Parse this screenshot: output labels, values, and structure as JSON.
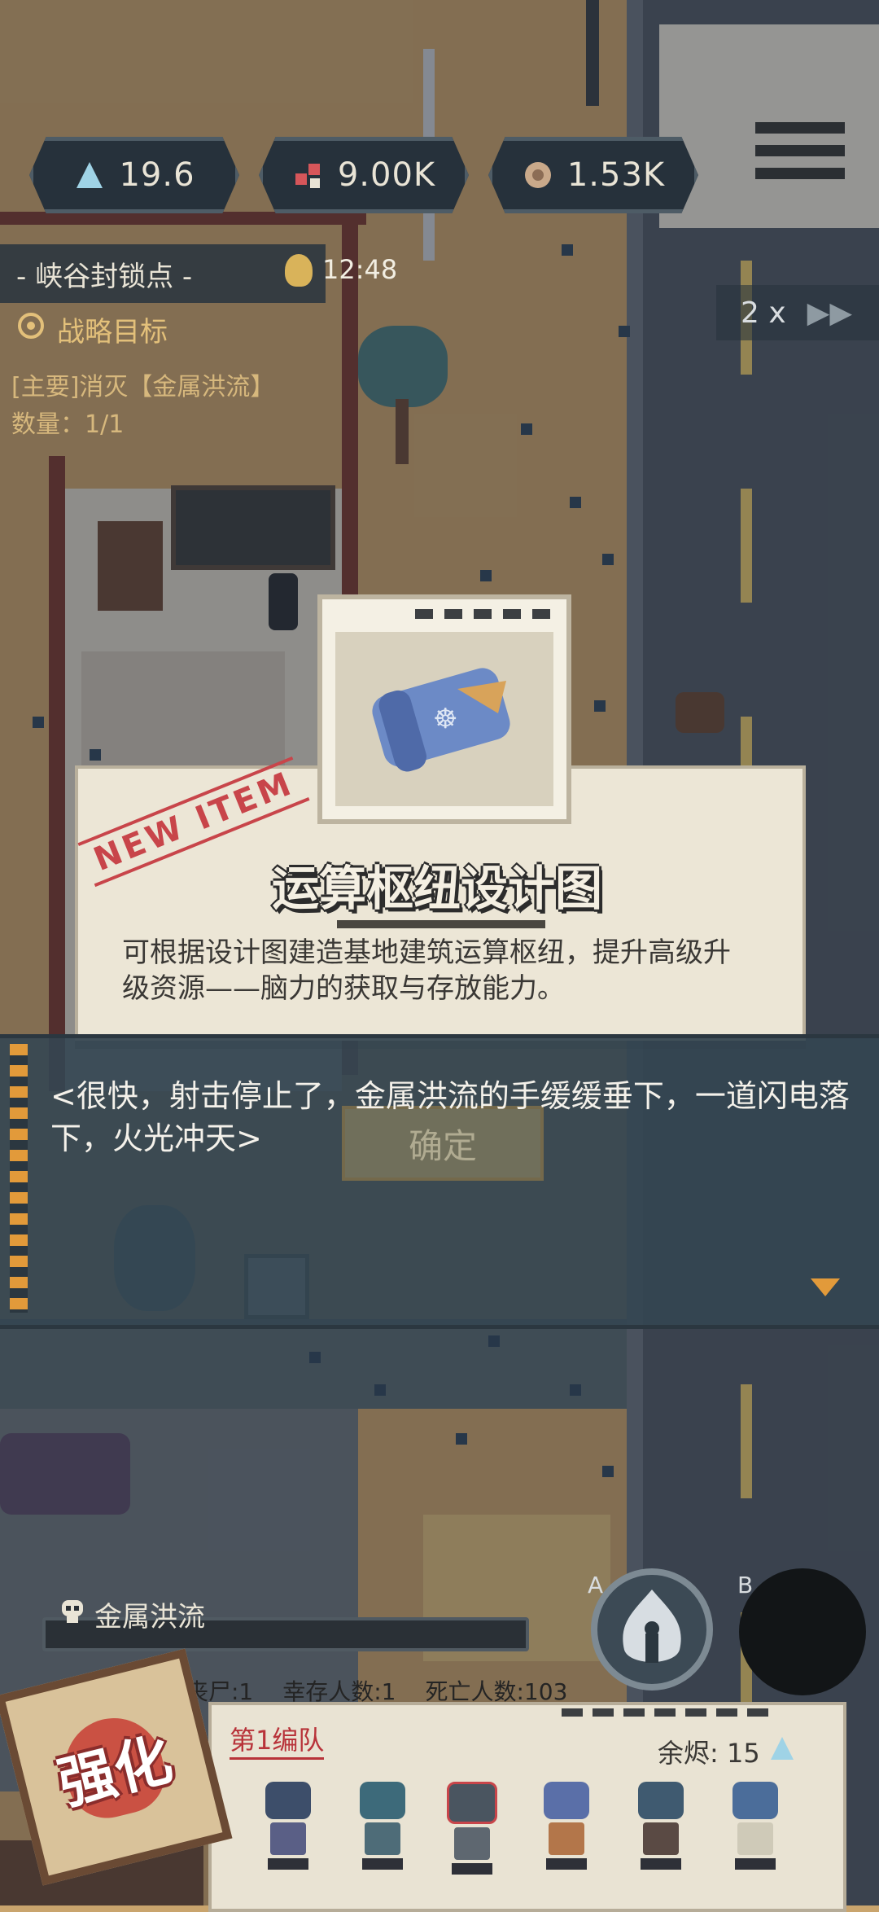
{
  "resources": [
    {
      "icon": "triangle-icon",
      "value": "19.6"
    },
    {
      "icon": "chips-icon",
      "value": "9.00K"
    },
    {
      "icon": "ore-icon",
      "value": "1.53K"
    }
  ],
  "location": "- 峡谷封锁点 -",
  "timer": "12:48",
  "objective": {
    "heading": "战略目标",
    "line": "[主要]消灭【金属洪流】",
    "count": "数量：1/1"
  },
  "speed": {
    "value": "2",
    "multiplier": "x",
    "arrows": "▶▶"
  },
  "new_item": {
    "stamp": "NEW ITEM",
    "name": "运算枢纽设计图",
    "description": "可根据设计图建造基地建筑运算枢纽，提升高级升级资源——脑力的获取与存放能力。"
  },
  "dialog": {
    "text": "<很快，射击停止了，金属洪流的手缓缓垂下，一道闪电落下，火光冲天>",
    "confirm_label": "确定"
  },
  "boss": {
    "name": "金属洪流",
    "hp_fraction": 0.0
  },
  "skills": {
    "a_label": "A",
    "b_label": "B"
  },
  "stats": {
    "zombies": "丧尸:1",
    "survivors": "幸存人数:1",
    "deaths": "死亡人数:103"
  },
  "squad": {
    "name": "第1编队",
    "spare": "余烬: 15"
  },
  "upgrade_label": "强化",
  "colors": {
    "accent": "#e29a3a",
    "stamp": "#c8454a",
    "panel": "#26313b"
  }
}
